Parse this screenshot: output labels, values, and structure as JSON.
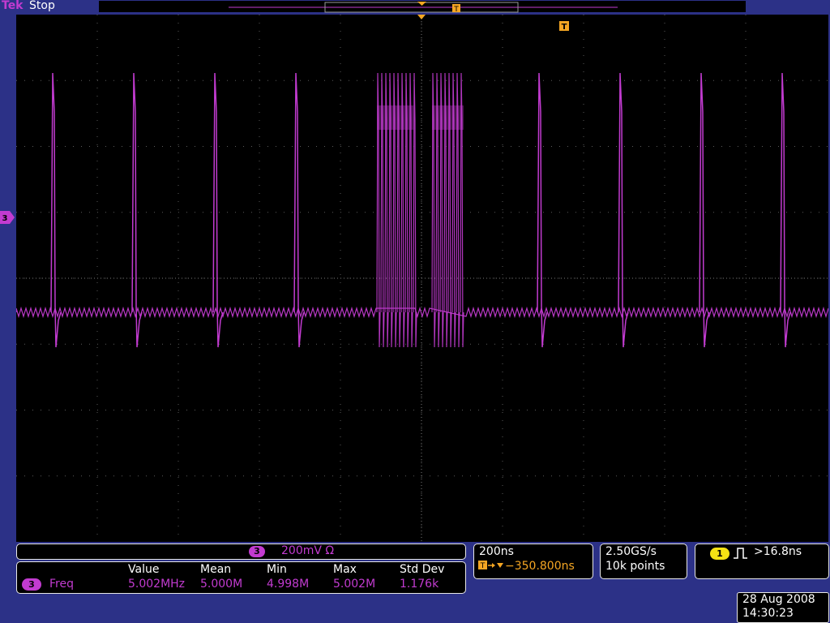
{
  "header": {
    "brand": "Tek",
    "run_state": "Stop"
  },
  "channel": {
    "number": "3",
    "scale": "200mV Ω",
    "color": "#c23bd0"
  },
  "measurement": {
    "channel": "3",
    "name": "Freq",
    "columns": [
      "Value",
      "Mean",
      "Min",
      "Max",
      "Std Dev"
    ],
    "values": [
      "5.002MHz",
      "5.000M",
      "4.998M",
      "5.002M",
      "1.176k"
    ]
  },
  "timebase": {
    "per_div": "200ns",
    "trigger_position": "−350.800ns"
  },
  "acquisition": {
    "sample_rate": "2.50GS/s",
    "record_length": "10k points"
  },
  "trigger": {
    "source": "1",
    "condition": ">16.8ns",
    "marker": "T",
    "color": "#f5a623"
  },
  "datetime": {
    "date": "28 Aug 2008",
    "time": "14:30:23"
  },
  "colors": {
    "background": "#2c3187",
    "screen": "#000000",
    "trace": "#c23bd0",
    "trigger": "#f5a623"
  }
}
